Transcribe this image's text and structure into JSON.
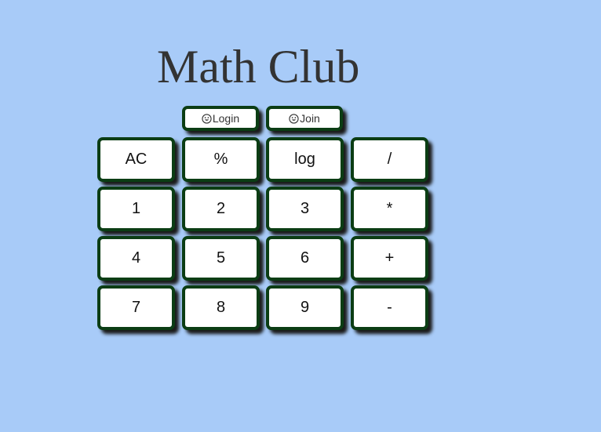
{
  "page": {
    "title": "Math Club"
  },
  "auth": {
    "login_icon": "smiley-icon",
    "login_label": "Login",
    "join_icon": "smiley-icon",
    "join_label": "Join"
  },
  "keypad": {
    "rows": [
      [
        "AC",
        "%",
        "log",
        "/"
      ],
      [
        "1",
        "2",
        "3",
        "*"
      ],
      [
        "4",
        "5",
        "6",
        "+"
      ],
      [
        "7",
        "8",
        "9",
        "-"
      ]
    ]
  },
  "colors": {
    "background": "#a8cbf8",
    "button_border": "#0b3d14",
    "button_fill": "#ffffff",
    "title_text": "#333333"
  }
}
